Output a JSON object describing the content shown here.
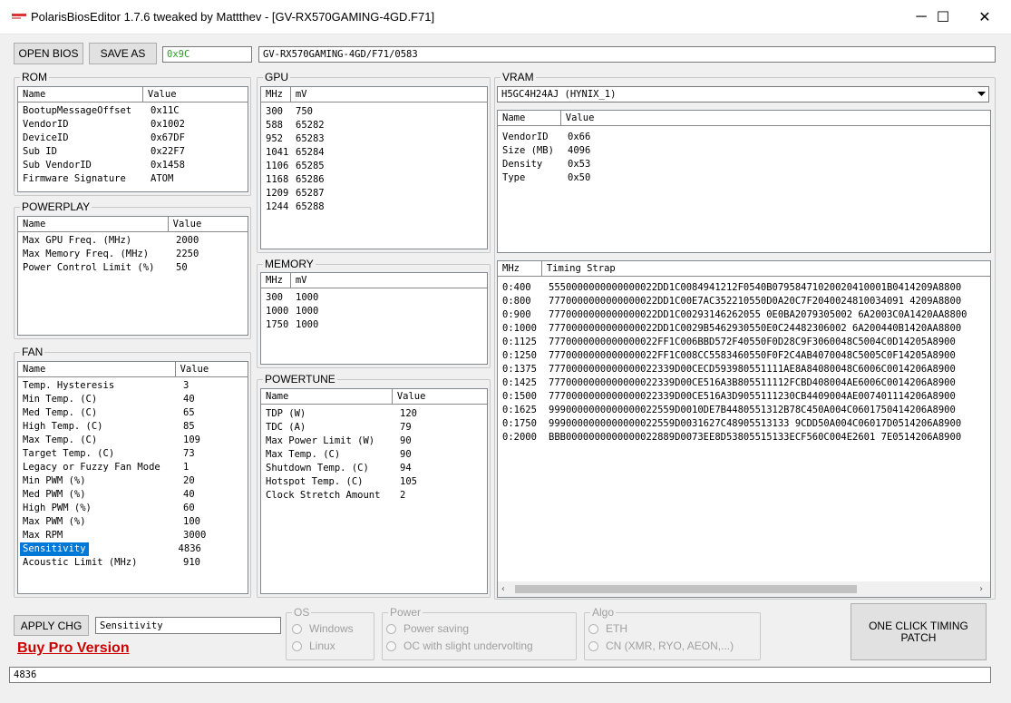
{
  "window": {
    "title": "PolarisBiosEditor 1.7.6 tweaked by Mattthev  - [GV-RX570GAMING-4GD.F71]",
    "minimize": "─",
    "maximize": "☐",
    "close": "✕"
  },
  "toolbar": {
    "open_bios": "OPEN BIOS",
    "save_as": "SAVE AS",
    "checksum": "0x9C",
    "bios_name": "GV-RX570GAMING-4GD/F71/0583"
  },
  "rom": {
    "legend": "ROM",
    "headers": [
      "Name",
      "Value"
    ],
    "rows": [
      [
        "BootupMessageOffset",
        "0x11C"
      ],
      [
        "VendorID",
        "0x1002"
      ],
      [
        "DeviceID",
        "0x67DF"
      ],
      [
        "Sub ID",
        "0x22F7"
      ],
      [
        "Sub VendorID",
        "0x1458"
      ],
      [
        "Firmware Signature",
        "ATOM"
      ]
    ]
  },
  "powerplay": {
    "legend": "POWERPLAY",
    "headers": [
      "Name",
      "Value"
    ],
    "rows": [
      [
        "Max GPU Freq. (MHz)",
        "2000"
      ],
      [
        "Max Memory Freq. (MHz)",
        "2250"
      ],
      [
        "Power Control Limit (%)",
        "50"
      ]
    ]
  },
  "fan": {
    "legend": "FAN",
    "headers": [
      "Name",
      "Value"
    ],
    "rows": [
      [
        "Temp. Hysteresis",
        "3"
      ],
      [
        "Min Temp. (C)",
        "40"
      ],
      [
        "Med Temp. (C)",
        "65"
      ],
      [
        "High Temp. (C)",
        "85"
      ],
      [
        "Max Temp. (C)",
        "109"
      ],
      [
        "Target Temp. (C)",
        "73"
      ],
      [
        "Legacy or Fuzzy Fan Mode",
        "1"
      ],
      [
        "Min PWM (%)",
        "20"
      ],
      [
        "Med PWM (%)",
        "40"
      ],
      [
        "High PWM (%)",
        "60"
      ],
      [
        "Max PWM (%)",
        "100"
      ],
      [
        "Max RPM",
        "3000"
      ],
      [
        "Sensitivity",
        "4836"
      ],
      [
        "Acoustic Limit (MHz)",
        "910"
      ]
    ],
    "selected_index": 12
  },
  "gpu": {
    "legend": "GPU",
    "headers": [
      "MHz",
      "mV"
    ],
    "rows": [
      [
        "300",
        "750"
      ],
      [
        "588",
        "65282"
      ],
      [
        "952",
        "65283"
      ],
      [
        "1041",
        "65284"
      ],
      [
        "1106",
        "65285"
      ],
      [
        "1168",
        "65286"
      ],
      [
        "1209",
        "65287"
      ],
      [
        "1244",
        "65288"
      ]
    ]
  },
  "memory": {
    "legend": "MEMORY",
    "headers": [
      "MHz",
      "mV"
    ],
    "rows": [
      [
        "300",
        "1000"
      ],
      [
        "1000",
        "1000"
      ],
      [
        "1750",
        "1000"
      ]
    ]
  },
  "powertune": {
    "legend": "POWERTUNE",
    "headers": [
      "Name",
      "Value"
    ],
    "rows": [
      [
        "TDP (W)",
        "120"
      ],
      [
        "TDC (A)",
        "79"
      ],
      [
        "Max Power Limit (W)",
        "90"
      ],
      [
        "Max Temp. (C)",
        "90"
      ],
      [
        "Shutdown Temp. (C)",
        "94"
      ],
      [
        "Hotspot Temp. (C)",
        "105"
      ],
      [
        "Clock Stretch Amount",
        "2"
      ]
    ]
  },
  "vram": {
    "legend": "VRAM",
    "selected_chip": "H5GC4H24AJ (HYNIX_1)",
    "headers": [
      "Name",
      "Value"
    ],
    "rows": [
      [
        "VendorID",
        "0x66"
      ],
      [
        "Size (MB)",
        "4096"
      ],
      [
        "Density",
        "0x53"
      ],
      [
        "Type",
        "0x50"
      ]
    ],
    "timing_headers": [
      "MHz",
      "Timing Strap"
    ],
    "timings": [
      [
        "0:400",
        "5550000000000000022DD1C0084941212F0540B07958471020020410001B0414209A8800"
      ],
      [
        "0:800",
        "7770000000000000022DD1C00E7AC352210550D0A20C7F2040024810034091 4209A8800"
      ],
      [
        "0:900",
        "7770000000000000022DD1C00293146262055 0E0BA2079305002 6A2003C0A1420AA8800"
      ],
      [
        "0:1000",
        "7770000000000000022DD1C0029B5462930550E0C24482306002 6A200440B1420AA8800"
      ],
      [
        "0:1125",
        "7770000000000000022FF1C006BBD572F40550F0D28C9F3060048C5004C0D14205A8900"
      ],
      [
        "0:1250",
        "7770000000000000022FF1C008CC5583460550F0F2C4AB4070048C5005C0F14205A8900"
      ],
      [
        "0:1375",
        "7770000000000000022339D00CECD593980551111AE8A84080048C6006C0014206A8900"
      ],
      [
        "0:1425",
        "7770000000000000022339D00CE516A3B805511112FCBD408004AE6006C0014206A8900"
      ],
      [
        "0:1500",
        "7770000000000000022339D00CE516A3D9055111230CB4409004AE007401114206A8900"
      ],
      [
        "0:1625",
        "9990000000000000022559D0010DE7B4480551312B78C450A004C0601750414206A8900"
      ],
      [
        "0:1750",
        "9990000000000000022559D0031627C48905513133 9CDD50A004C06017D0514206A8900"
      ],
      [
        "0:2000",
        "BBB0000000000000022889D0073EE8D53805515133ECF560C004E2601 7E0514206A8900"
      ]
    ]
  },
  "bottom": {
    "apply_chg": "APPLY CHG",
    "edit_name": "Sensitivity",
    "buy_pro": "Buy Pro Version",
    "edit_value": "4836",
    "os_legend": "OS",
    "os_options": [
      "Windows",
      "Linux"
    ],
    "power_legend": "Power",
    "power_options": [
      "Power saving",
      "OC with slight undervolting"
    ],
    "algo_legend": "Algo",
    "algo_options": [
      "ETH",
      "CN (XMR, RYO, AEON,...)"
    ],
    "one_click": "ONE CLICK TIMING PATCH"
  }
}
